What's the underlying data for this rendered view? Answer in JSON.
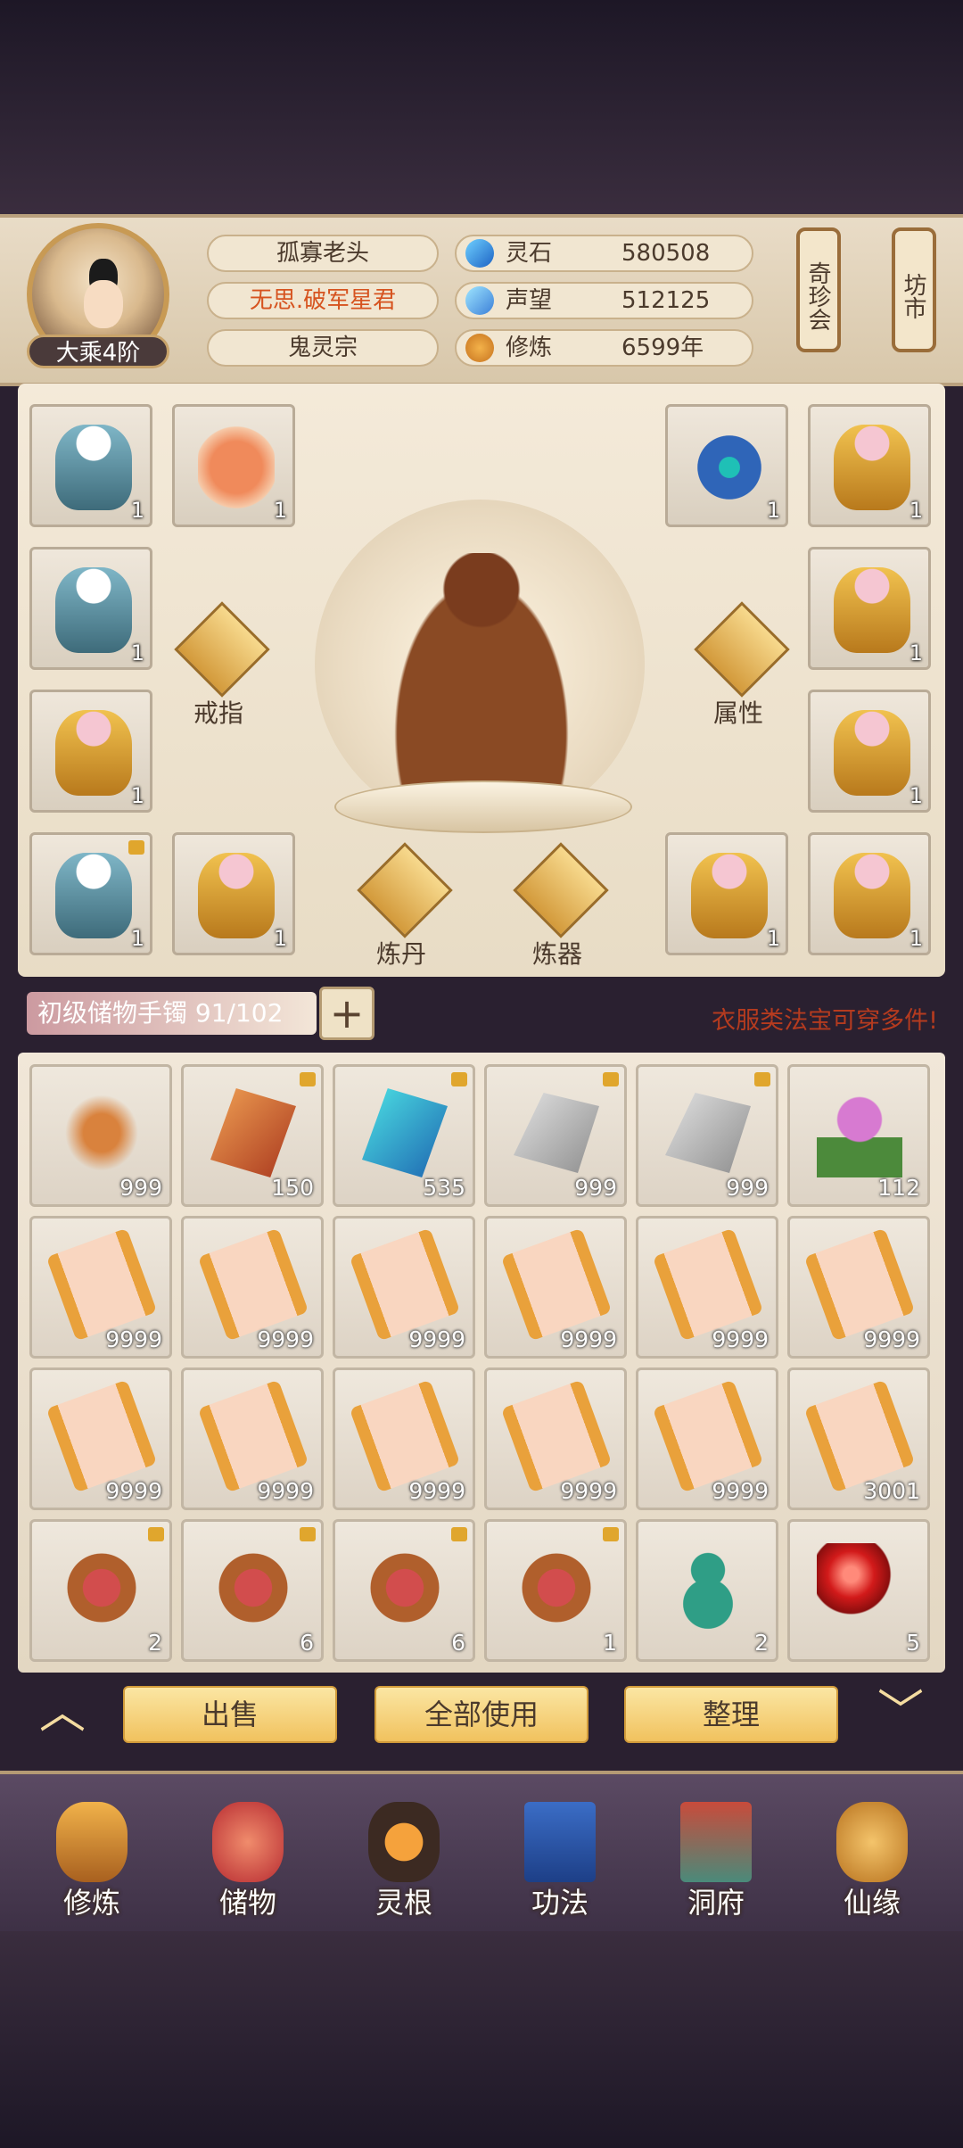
{
  "player": {
    "name": "孤寡老头",
    "title": "无思.破军星君",
    "sect": "鬼灵宗",
    "rank": "大乘4阶"
  },
  "stats": [
    {
      "label": "灵石",
      "value": "580508",
      "icon": "spirit-stone-icon"
    },
    {
      "label": "声望",
      "value": "512125",
      "icon": "prestige-crystal-icon"
    },
    {
      "label": "修炼",
      "value": "6599年",
      "icon": "meditation-icon"
    }
  ],
  "side_buttons": {
    "treasure_fair": "奇珍会",
    "market": "坊市"
  },
  "equipment": {
    "functions": {
      "ring": "戒指",
      "attributes": "属性",
      "alchemy": "炼丹",
      "forging": "炼器"
    },
    "slots": [
      {
        "item": "robe",
        "count": "1"
      },
      {
        "item": "dragon-pendant",
        "count": "1"
      },
      {
        "item": "jade-ring",
        "count": "1"
      },
      {
        "item": "golden-robe",
        "count": "1"
      },
      {
        "item": "robe",
        "count": "1"
      },
      {
        "item": "golden-robe",
        "count": "1"
      },
      {
        "item": "golden-robe",
        "count": "1"
      },
      {
        "item": "golden-robe",
        "count": "1"
      },
      {
        "item": "robe",
        "count": "1",
        "locked": true
      },
      {
        "item": "golden-robe",
        "count": "1"
      },
      {
        "item": "golden-robe",
        "count": "1"
      },
      {
        "item": "golden-robe",
        "count": "1"
      }
    ]
  },
  "storage": {
    "name": "初级储物手镯",
    "capacity": "91/102",
    "tip": "衣服类法宝可穿多件!"
  },
  "bag": [
    {
      "item": "herb-root",
      "count": "999",
      "locked": false
    },
    {
      "item": "red-crystal",
      "count": "150",
      "locked": true
    },
    {
      "item": "blue-crystal",
      "count": "535",
      "locked": true
    },
    {
      "item": "stone",
      "count": "999",
      "locked": true
    },
    {
      "item": "stone",
      "count": "999",
      "locked": true
    },
    {
      "item": "flower",
      "count": "112",
      "locked": false
    },
    {
      "item": "scroll",
      "count": "9999",
      "locked": false
    },
    {
      "item": "scroll",
      "count": "9999",
      "locked": false
    },
    {
      "item": "scroll",
      "count": "9999",
      "locked": false
    },
    {
      "item": "scroll",
      "count": "9999",
      "locked": false
    },
    {
      "item": "scroll",
      "count": "9999",
      "locked": false
    },
    {
      "item": "scroll",
      "count": "9999",
      "locked": false
    },
    {
      "item": "scroll",
      "count": "9999",
      "locked": false
    },
    {
      "item": "scroll",
      "count": "9999",
      "locked": false
    },
    {
      "item": "scroll",
      "count": "9999",
      "locked": false
    },
    {
      "item": "scroll",
      "count": "9999",
      "locked": false
    },
    {
      "item": "scroll",
      "count": "9999",
      "locked": false
    },
    {
      "item": "scroll",
      "count": "3001",
      "locked": false
    },
    {
      "item": "drum",
      "count": "2",
      "locked": true
    },
    {
      "item": "drum",
      "count": "6",
      "locked": true
    },
    {
      "item": "drum",
      "count": "6",
      "locked": true
    },
    {
      "item": "drum",
      "count": "1",
      "locked": true
    },
    {
      "item": "gourd",
      "count": "2",
      "locked": false
    },
    {
      "item": "red-orb",
      "count": "5",
      "locked": false
    }
  ],
  "actions": {
    "sell": "出售",
    "use_all": "全部使用",
    "sort": "整理"
  },
  "nav": [
    {
      "label": "修炼",
      "icon": "cultivation-icon"
    },
    {
      "label": "储物",
      "icon": "storage-bag-icon"
    },
    {
      "label": "灵根",
      "icon": "spirit-root-icon"
    },
    {
      "label": "功法",
      "icon": "technique-book-icon"
    },
    {
      "label": "洞府",
      "icon": "cave-mansion-icon"
    },
    {
      "label": "仙缘",
      "icon": "immortal-fate-icon"
    }
  ]
}
